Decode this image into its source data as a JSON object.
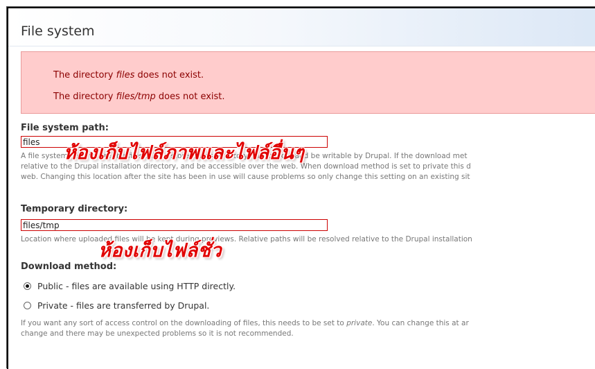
{
  "page": {
    "title": "File system"
  },
  "errors": {
    "msg1_prefix": "The directory ",
    "msg1_em": "files",
    "msg1_suffix": " does not exist.",
    "msg2_prefix": "The directory ",
    "msg2_em": "files/tmp",
    "msg2_suffix": " does not exist."
  },
  "file_system_path": {
    "label": "File system path:",
    "value": "files",
    "desc_line1": "A file system path where the files will be stored. This directory has to exist and be writable by Drupal. If the download met",
    "desc_line2": "relative to the Drupal installation directory, and be accessible over the web. When download method is set to private this d",
    "desc_line3": "web. Changing this location after the site has been in use will cause problems so only change this setting on an existing sit",
    "overlay_text": "ห้องเก็บไฟล์ภาพและไฟล์อื่นๆ"
  },
  "temp_directory": {
    "label": "Temporary directory:",
    "value": "files/tmp",
    "desc_line1": "Location where uploaded files will be kept during previews. Relative paths will be resolved relative to the Drupal installation",
    "overlay_text": "ห้องเก็บไฟล์ชั่ว"
  },
  "download_method": {
    "label": "Download method:",
    "options": [
      {
        "label": "Public - files are available using HTTP directly.",
        "checked": true
      },
      {
        "label": "Private - files are transferred by Drupal.",
        "checked": false
      }
    ],
    "desc_line1_prefix": "If you want any sort of access control on the downloading of files, this needs to be set to ",
    "desc_line1_em": "private",
    "desc_line1_suffix": ". You can change this at ar",
    "desc_line2": "change and there may be unexpected problems so it is not recommended."
  },
  "colors": {
    "error_bg": "#ffcccc",
    "error_text": "#8b0000",
    "input_border": "#cc0000",
    "overlay_red": "#e10000"
  }
}
